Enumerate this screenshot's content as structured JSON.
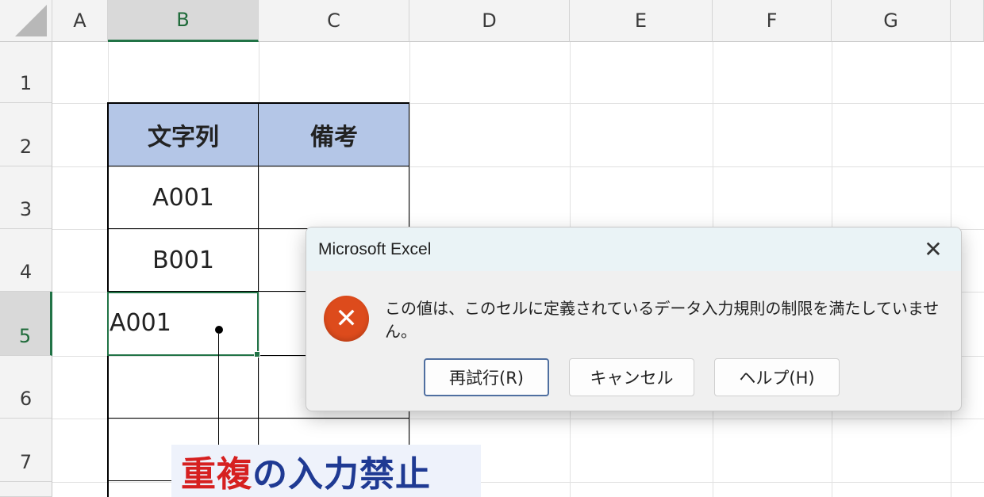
{
  "columns": [
    "A",
    "B",
    "C",
    "D",
    "E",
    "F",
    "G"
  ],
  "rows": [
    "1",
    "2",
    "3",
    "4",
    "5",
    "6",
    "7"
  ],
  "selected_column": "B",
  "selected_row": "5",
  "table": {
    "header": [
      "文字列",
      "備考"
    ],
    "b3": "A001",
    "b4": "B001",
    "b5_input": "A001"
  },
  "annotation": {
    "part1": "重複",
    "part2": "の入力禁止"
  },
  "dialog": {
    "title": "Microsoft Excel",
    "close": "✕",
    "error_icon": "error-x-icon",
    "error_glyph": "✕",
    "message": "この値は、このセルに定義されているデータ入力規則の制限を満たしていません。",
    "buttons": {
      "retry": "再試行(R)",
      "cancel": "キャンセル",
      "help": "ヘルプ(H)"
    }
  },
  "colors": {
    "header_fill": "#b4c6e7",
    "selection_green": "#217346",
    "error_red": "#dd4b1c",
    "annotation_red": "#d62020",
    "annotation_blue": "#1f3a93"
  }
}
